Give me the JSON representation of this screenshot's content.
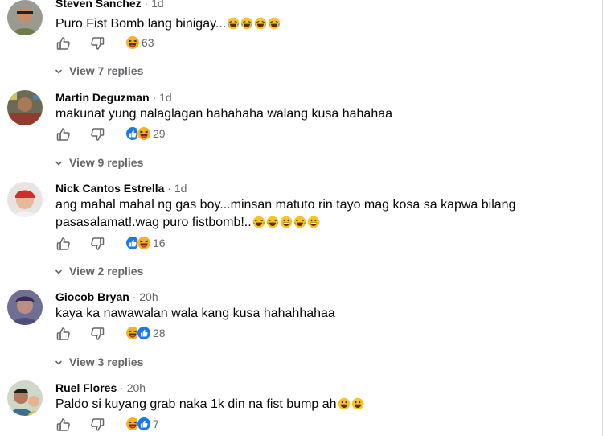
{
  "comments": [
    {
      "name": "Steven Sanchez",
      "age": "1d",
      "text": "Puro Fist Bomb lang binigay...",
      "emojis": [
        "laughing-tears",
        "laughing-tears",
        "laughing-tears",
        "laughing-tears"
      ],
      "reactions": [
        "haha"
      ],
      "count": "63",
      "replies": "View 7 replies"
    },
    {
      "name": "Martin Deguzman",
      "age": "1d",
      "text": "makunat yung nalaglagan hahahaha walang kusa hahahaa",
      "emojis": [],
      "reactions": [
        "like",
        "haha"
      ],
      "count": "29",
      "replies": "View 9 replies"
    },
    {
      "name": "Nick Cantos Estrella",
      "age": "1d",
      "text": "ang mahal mahal ng gas boy...minsan matuto rin tayo mag kosa sa kapwa bilang pasasalamat!.wag puro fistbomb!..",
      "emojis": [
        "laughing-tears",
        "laughing-tears",
        "grin",
        "laughing-tears",
        "grin"
      ],
      "reactions": [
        "like",
        "haha"
      ],
      "count": "16",
      "replies": "View 2 replies"
    },
    {
      "name": "Giocob Bryan",
      "age": "20h",
      "text": "kaya ka nawawalan wala kang kusa hahahhahaa",
      "emojis": [],
      "reactions": [
        "haha",
        "like"
      ],
      "count": "28",
      "replies": "View 3 replies"
    },
    {
      "name": "Ruel Flores",
      "age": "20h",
      "text": "Paldo si kuyang grab naka 1k din na fist bump ah",
      "emojis": [
        "grin",
        "grin"
      ],
      "reactions": [
        "haha",
        "like"
      ],
      "count": "7",
      "replies": ""
    }
  ],
  "colors": {
    "like_blue": "#1877f2",
    "haha_yellow": "#f7b125",
    "meta_gray": "#65676b",
    "text": "#050505"
  }
}
